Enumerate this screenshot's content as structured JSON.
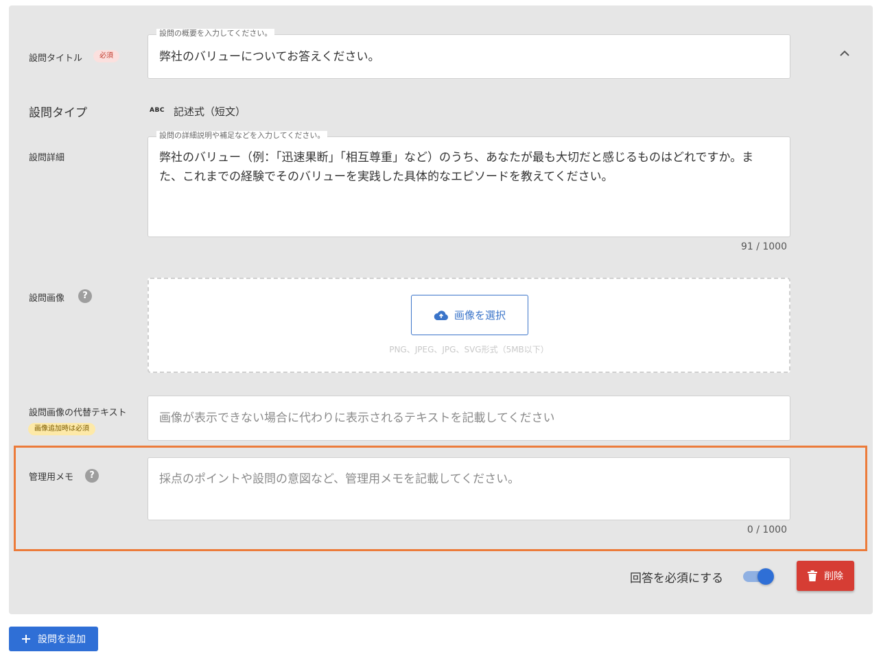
{
  "question_title": {
    "label": "設問タイトル",
    "required_badge": "必須",
    "legend": "設問の概要を入力してください。",
    "value": "弊社のバリューについてお答えください。"
  },
  "question_type": {
    "label": "設問タイプ",
    "icon_text": "ABC",
    "value": "記述式（短文）"
  },
  "question_detail": {
    "label": "設問詳細",
    "legend": "設問の詳細説明や補足などを入力してください。",
    "value": "弊社のバリュー（例：「迅速果断」「相互尊重」など）のうち、あなたが最も大切だと感じるものはどれですか。また、これまでの経験でそのバリューを実践した具体的なエピソードを教えてください。",
    "counter": "91 / 1000"
  },
  "question_image": {
    "label": "設問画像",
    "help": "?",
    "select_button": "画像を選択",
    "hint": "PNG、JPEG、JPG、SVG形式（5MB以下）"
  },
  "alt_text": {
    "label": "設問画像の代替テキスト",
    "badge": "画像追加時は必須",
    "placeholder": "画像が表示できない場合に代わりに表示されるテキストを記載してください"
  },
  "admin_memo": {
    "label": "管理用メモ",
    "help": "?",
    "placeholder": "採点のポイントや設問の意図など、管理用メモを記載してください。",
    "counter": "0 / 1000"
  },
  "footer": {
    "required_toggle_label": "回答を必須にする",
    "required_toggle_on": true,
    "delete_button": "削除",
    "add_question_button": "設問を追加"
  },
  "colors": {
    "primary": "#2f6fd6",
    "danger": "#d63d34",
    "highlight": "#ec7b3a",
    "card_bg": "#e6e6e6"
  }
}
